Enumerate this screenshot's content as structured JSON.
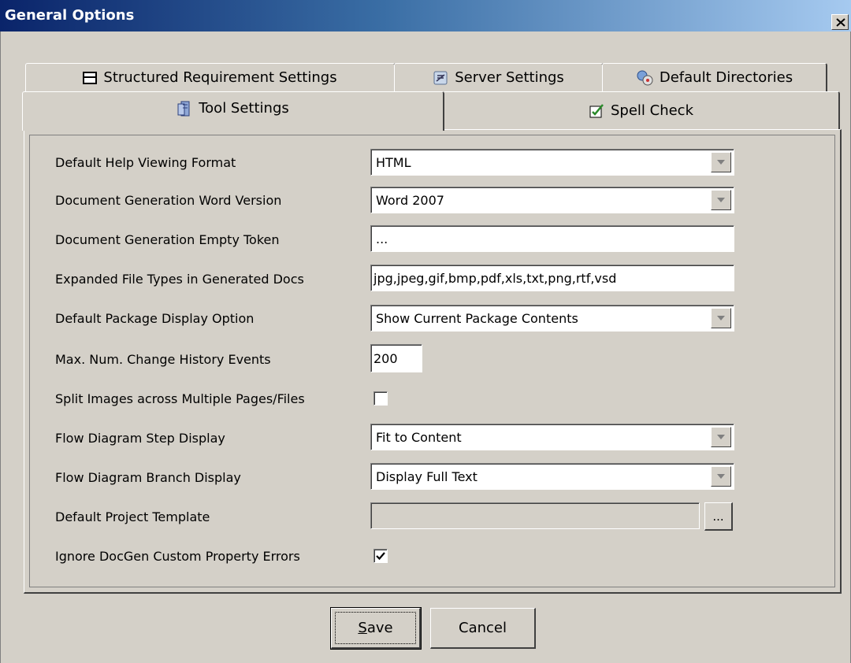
{
  "window": {
    "title": "General Options",
    "close_glyph": "×"
  },
  "tabs_back": [
    {
      "label": "Structured Requirement Settings",
      "icon": "requirement-icon"
    },
    {
      "label": "Server Settings",
      "icon": "server-icon"
    },
    {
      "label": "Default Directories",
      "icon": "directories-icon"
    }
  ],
  "tabs_front": [
    {
      "label": "Tool Settings",
      "icon": "tool-settings-icon",
      "selected": true
    },
    {
      "label": "Spell Check",
      "icon": "spell-check-icon",
      "selected": false
    }
  ],
  "settings": {
    "help_format": {
      "label": "Default Help Viewing Format",
      "value": "HTML"
    },
    "word_version": {
      "label": "Document Generation Word Version",
      "value": "Word 2007"
    },
    "empty_token": {
      "label": "Document Generation Empty Token",
      "value": "..."
    },
    "file_types": {
      "label": "Expanded File Types in Generated Docs",
      "value": "jpg,jpeg,gif,bmp,pdf,xls,txt,png,rtf,vsd"
    },
    "package_display": {
      "label": "Default Package Display Option",
      "value": "Show Current Package Contents"
    },
    "max_history": {
      "label": "Max. Num. Change History Events",
      "value": "200"
    },
    "split_images": {
      "label": "Split Images across Multiple Pages/Files",
      "checked": false
    },
    "step_display": {
      "label": "Flow Diagram Step Display",
      "value": "Fit to Content"
    },
    "branch_display": {
      "label": "Flow Diagram Branch Display",
      "value": "Display Full Text"
    },
    "project_template": {
      "label": "Default Project Template",
      "value": "",
      "browse_label": "..."
    },
    "ignore_errors": {
      "label": "Ignore DocGen Custom Property Errors",
      "checked": true
    }
  },
  "buttons": {
    "save_mnemonic": "S",
    "save_rest": "ave",
    "cancel": "Cancel"
  }
}
